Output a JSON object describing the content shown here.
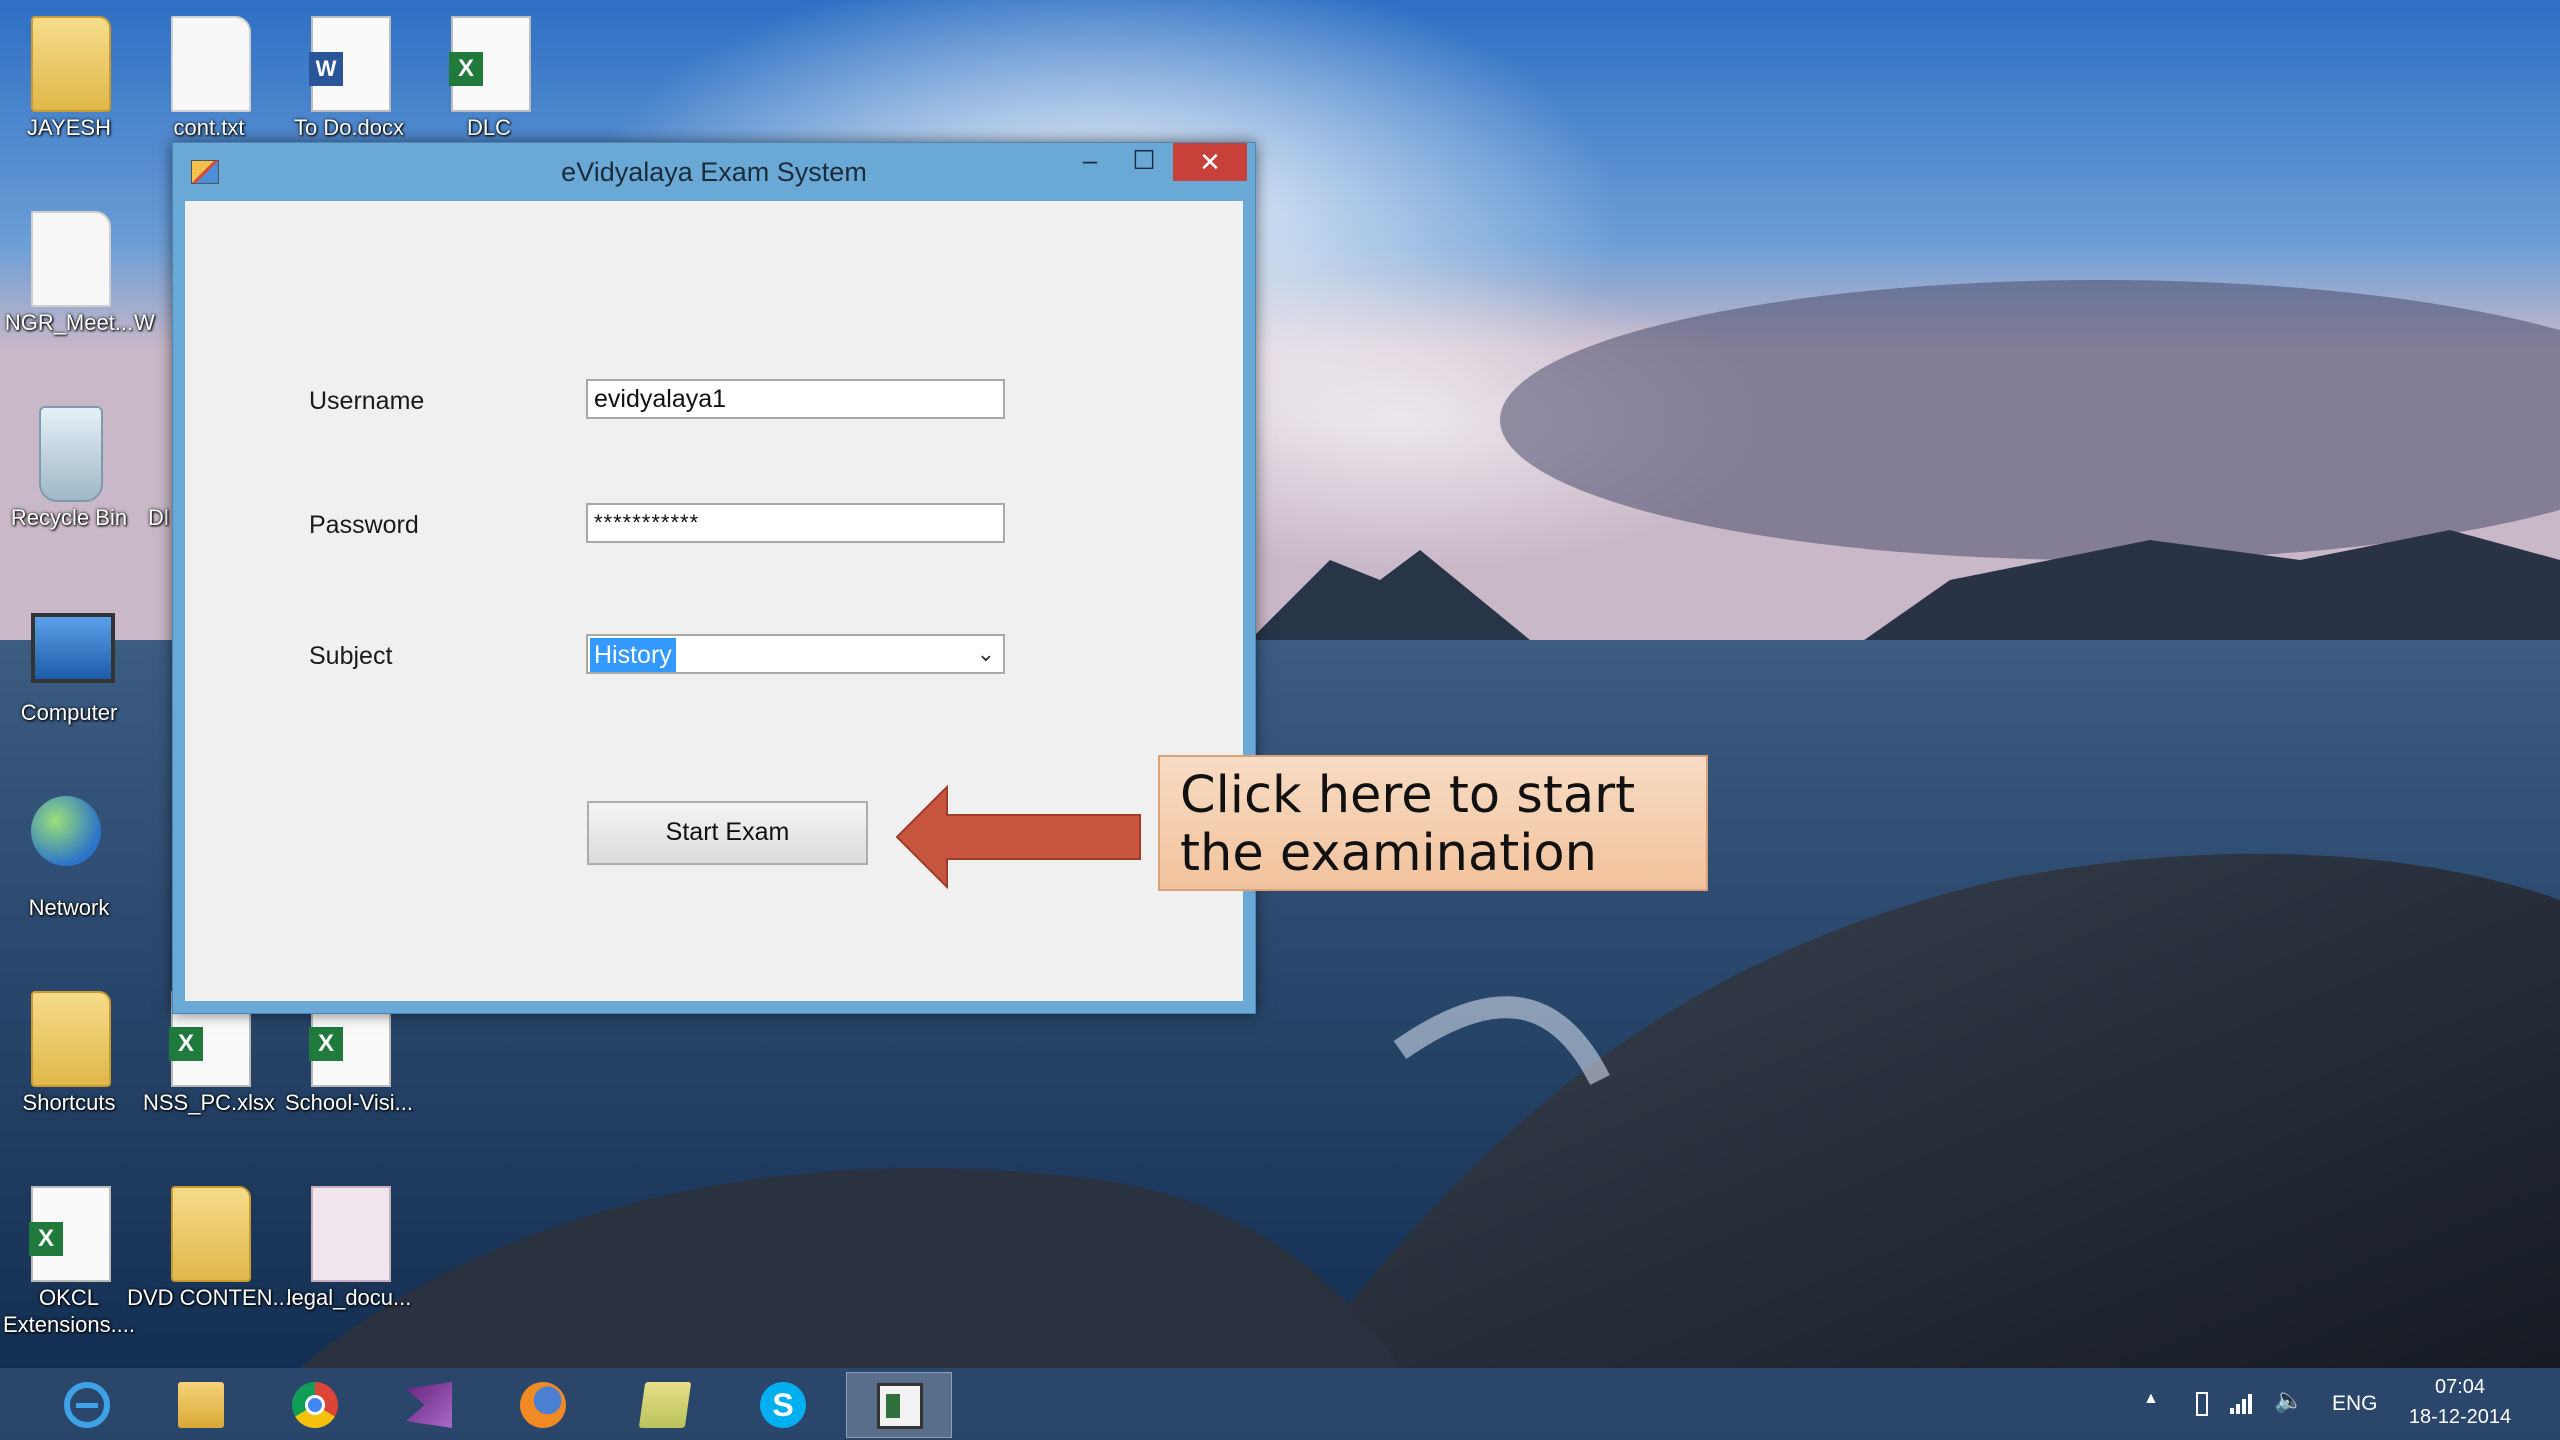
{
  "desktop": {
    "icons": [
      {
        "label": "JAYESH",
        "icon": "user-folder-icon"
      },
      {
        "label": "cont.txt",
        "icon": "text-file-icon"
      },
      {
        "label": "To Do.docx",
        "icon": "word-document-icon"
      },
      {
        "label": "DLC",
        "icon": "excel-file-icon"
      },
      {
        "label": "NGR_Meet...",
        "icon": "text-file-icon"
      },
      {
        "label": "W",
        "icon": "partial-icon"
      },
      {
        "label": "Recycle Bin",
        "icon": "recycle-bin-icon"
      },
      {
        "label": "Dl",
        "icon": "partial-icon"
      },
      {
        "label": "Computer",
        "icon": "computer-icon"
      },
      {
        "label": "Network",
        "icon": "network-icon"
      },
      {
        "label": "Shortcuts",
        "icon": "folder-icon"
      },
      {
        "label": "NSS_PC.xlsx",
        "icon": "excel-file-icon"
      },
      {
        "label": "School-Visi...",
        "icon": "excel-file-icon"
      },
      {
        "label": "OKCL Extensions....",
        "icon": "excel-file-icon"
      },
      {
        "label": "DVD CONTEN...",
        "icon": "folder-icon"
      },
      {
        "label": "legal_docu...",
        "icon": "pdf-file-icon"
      }
    ]
  },
  "window": {
    "title": "eVidyalaya Exam System",
    "minimize": "–",
    "maximize": "☐",
    "close": "✕"
  },
  "form": {
    "username_label": "Username",
    "username_value": "evidyalaya1",
    "password_label": "Password",
    "password_value": "***********",
    "subject_label": "Subject",
    "subject_value": "History",
    "start_button": "Start Exam"
  },
  "callout": {
    "text": "Click here to start the examination",
    "arrow_color": "#c8553d",
    "box_color": "#f6d3b6"
  },
  "taskbar": {
    "apps": [
      {
        "name": "internet-explorer",
        "active": false
      },
      {
        "name": "file-explorer",
        "active": false
      },
      {
        "name": "chrome",
        "active": false
      },
      {
        "name": "visual-studio",
        "active": false
      },
      {
        "name": "firefox",
        "active": false
      },
      {
        "name": "folders",
        "active": false
      },
      {
        "name": "skype",
        "active": false
      },
      {
        "name": "exam-app",
        "active": true
      }
    ],
    "tray": {
      "chevron": "▲",
      "volume": "🔈",
      "language": "ENG",
      "time": "07:04",
      "date": "18-12-2014"
    }
  }
}
